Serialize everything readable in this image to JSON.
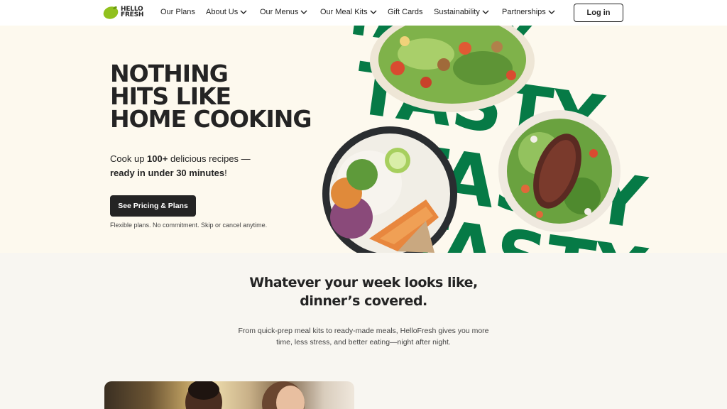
{
  "nav": {
    "logo_line1": "HELLO",
    "logo_line2": "FRESH",
    "items": [
      {
        "label": "Our Plans",
        "dropdown": false
      },
      {
        "label": "About Us",
        "dropdown": true
      },
      {
        "label": "Our Menus",
        "dropdown": true
      },
      {
        "label": "Our Meal Kits",
        "dropdown": true
      },
      {
        "label": "Gift Cards",
        "dropdown": false
      },
      {
        "label": "Sustainability",
        "dropdown": true
      },
      {
        "label": "Partnerships",
        "dropdown": true
      }
    ],
    "login_label": "Log in"
  },
  "hero": {
    "headline": [
      "NOTHING",
      "HITS LIKE",
      "HOME COOKING"
    ],
    "sub_part1": "Cook up ",
    "sub_bold1": "100+",
    "sub_part2": " delicious recipes  —",
    "sub_bold2": "ready in under 30 minutes",
    "sub_part3": "!",
    "cta_label": "See Pricing & Plans",
    "fine_print": "Flexible plans. No commitment. Skip or cancel anytime.",
    "background_word": "TASTY"
  },
  "section": {
    "title_line1": "Whatever your week looks like,",
    "title_line2": "dinner’s covered.",
    "body_line1": "From quick-prep meal kits to ready-made meals, HelloFresh gives you more",
    "body_line2": "time, less stress, and better eating—night after night."
  },
  "colors": {
    "brand_green": "#067a46",
    "logo_green": "#91c11e",
    "dark": "#242424",
    "hero_bg": "#fdf9ee"
  }
}
